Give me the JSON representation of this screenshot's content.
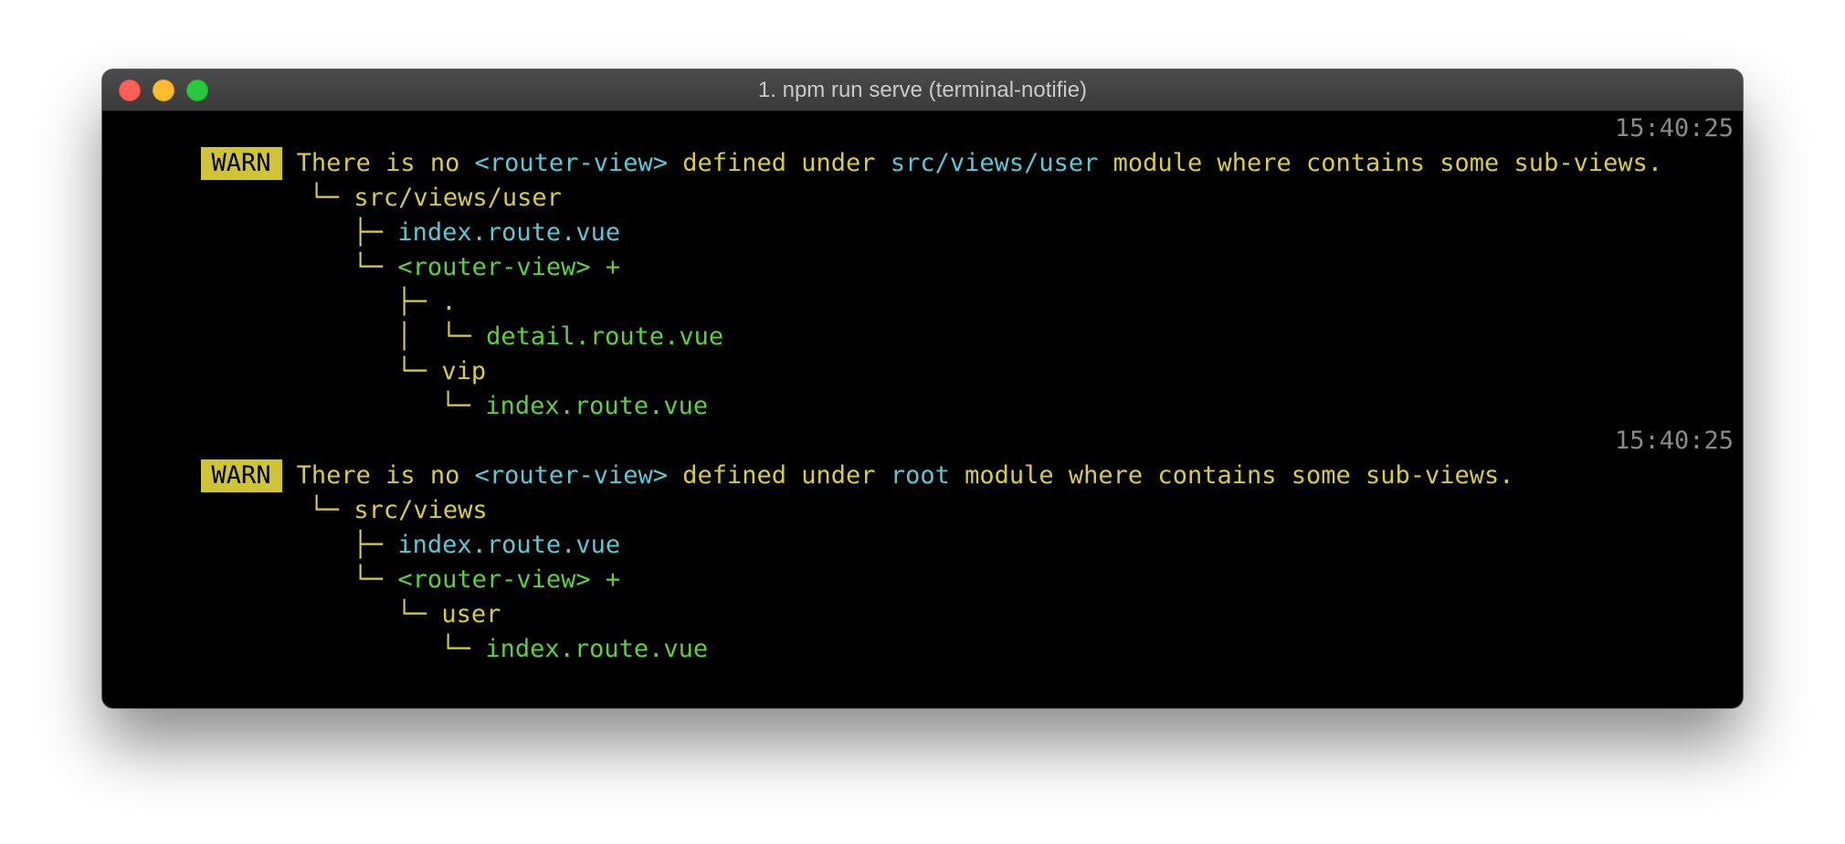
{
  "window": {
    "title": "1. npm run serve (terminal-notifie)"
  },
  "colors": {
    "warn_bg": "#cfc435",
    "yellow": "#d8cb46",
    "cyan": "#5fc6d4",
    "green": "#5fcf3d",
    "timestamp": "#8a8a8a"
  },
  "warnings": [
    {
      "badge": "WARN",
      "msg_a": "There is no ",
      "tag": "<router-view>",
      "msg_b": " defined under ",
      "path": "src/views/user",
      "msg_c": " module where contains some sub-views.",
      "time": "15:40:25",
      "tree": {
        "l1": "└─ src/views/user",
        "l2_branch": "├─ ",
        "l2_file": "index.route.vue",
        "l3_branch": "└─ ",
        "l3_label": "<router-view> +",
        "l4": "├─ .",
        "l5_branch": "│  └─ ",
        "l5_file": "detail.route.vue",
        "l6": "└─ vip",
        "l7_branch": "└─ ",
        "l7_file": "index.route.vue"
      }
    },
    {
      "badge": "WARN",
      "msg_a": "There is no ",
      "tag": "<router-view>",
      "msg_b": " defined under ",
      "path": "root",
      "msg_c": " module where contains some sub-views.",
      "time": "15:40:25",
      "tree": {
        "l1": "└─ src/views",
        "l2_branch": "├─ ",
        "l2_file": "index.route.vue",
        "l3_branch": "└─ ",
        "l3_label": "<router-view> +",
        "l4": "└─ user",
        "l5_branch": "└─ ",
        "l5_file": "index.route.vue"
      }
    }
  ]
}
